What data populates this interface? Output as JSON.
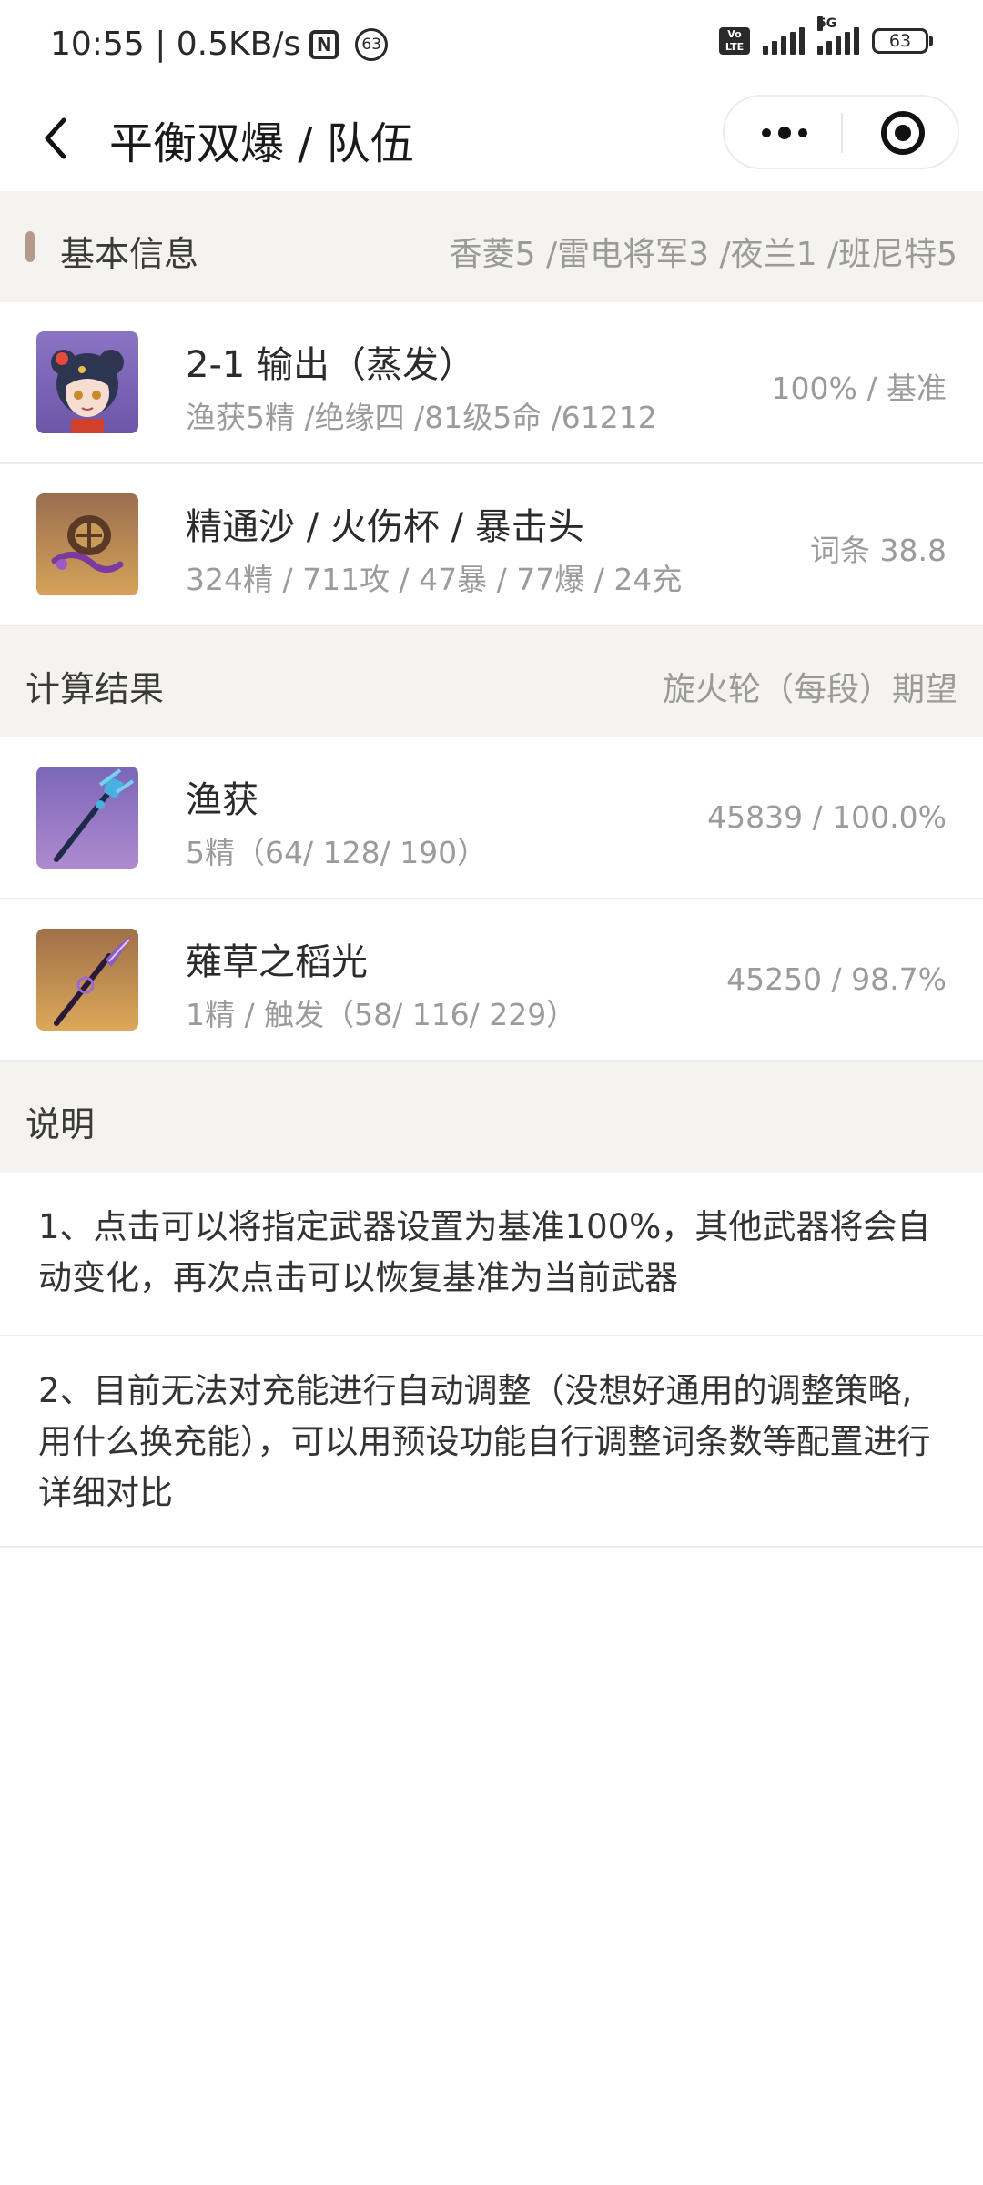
{
  "status_bar": {
    "time_speed": "10:55 | 0.5KB/s",
    "nfc_glyph": "N",
    "notification_count": "63",
    "volte": "Vo LTE",
    "network": "5G",
    "battery": "63"
  },
  "nav": {
    "title": "平衡双爆 / 队伍"
  },
  "basic_info": {
    "title": "基本信息",
    "team": "香菱5 /雷电将军3 /夜兰1 /班尼特5",
    "rows": [
      {
        "title": "2-1 输出（蒸发）",
        "sub": "渔获5精 /绝缘四 /81级5命 /61212",
        "value": "100% / 基准",
        "icon": "character-portrait-icon"
      },
      {
        "title": "精通沙 / 火伤杯 / 暴击头",
        "sub": "324精 / 711攻 / 47暴 / 77爆 / 24充",
        "value": "词条 38.8",
        "icon": "artifact-icon"
      }
    ]
  },
  "results": {
    "title": "计算结果",
    "extra": "旋火轮（每段）期望",
    "rows": [
      {
        "title": "渔获",
        "sub": "5精（64/ 128/ 190）",
        "value": "45839 / 100.0%",
        "icon": "polearm-catch-icon"
      },
      {
        "title": "薙草之稻光",
        "sub": "1精 / 触发（58/ 116/ 229）",
        "value": "45250 / 98.7%",
        "icon": "polearm-grasscutter-icon"
      }
    ]
  },
  "notes": {
    "title": "说明",
    "items": [
      "1、点击可以将指定武器设置为基准100%，其他武器将会自动变化，再次点击可以恢复基准为当前武器",
      "2、目前无法对充能进行自动调整（没想好通用的调整策略,用什么换充能），可以用预设功能自行调整词条数等配置进行详细对比"
    ]
  },
  "colors": {
    "section_bg": "#f5f3ef",
    "accent": "#b59a8c",
    "muted_text": "#9b9b9b",
    "divider": "#ececec"
  }
}
